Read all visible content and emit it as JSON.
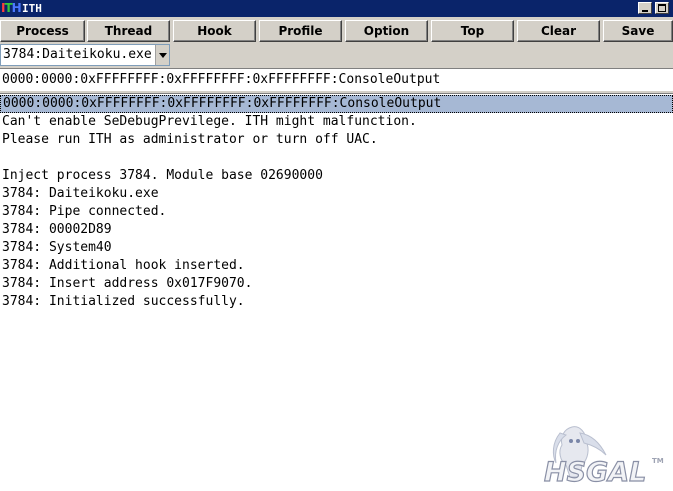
{
  "window": {
    "title": "ITH",
    "icon_text": [
      "I",
      "T",
      "H"
    ],
    "controls": [
      "minimize-icon",
      "maximize-icon"
    ]
  },
  "toolbar": {
    "buttons": [
      "Process",
      "Thread",
      "Hook",
      "Profile",
      "Option",
      "Top",
      "Clear",
      "Save"
    ]
  },
  "process_select": {
    "value": "3784:Daiteikoku.exe",
    "icon": "chevron-down-icon"
  },
  "hook_select": {
    "value": "0000:0000:0xFFFFFFFF:0xFFFFFFFF:0xFFFFFFFF:ConsoleOutput"
  },
  "output": {
    "selected_line": "0000:0000:0xFFFFFFFF:0xFFFFFFFF:0xFFFFFFFF:ConsoleOutput",
    "lines": [
      "Can't enable SeDebugPrevilege. ITH might malfunction.",
      "Please run ITH as administrator or turn off UAC.",
      "",
      "Inject process 3784. Module base 02690000",
      "3784: Daiteikoku.exe",
      "3784: Pipe connected.",
      "3784: 00002D89",
      "3784: System40",
      "3784: Additional hook inserted.",
      "3784: Insert address 0x017F9070.",
      "3784: Initialized successfully."
    ]
  },
  "logo": {
    "text": "HSGAL",
    "mark": "TM"
  },
  "colors": {
    "titlebar": "#0a246a",
    "button_face": "#d4d0c8",
    "selection": "#a6b8d4"
  }
}
